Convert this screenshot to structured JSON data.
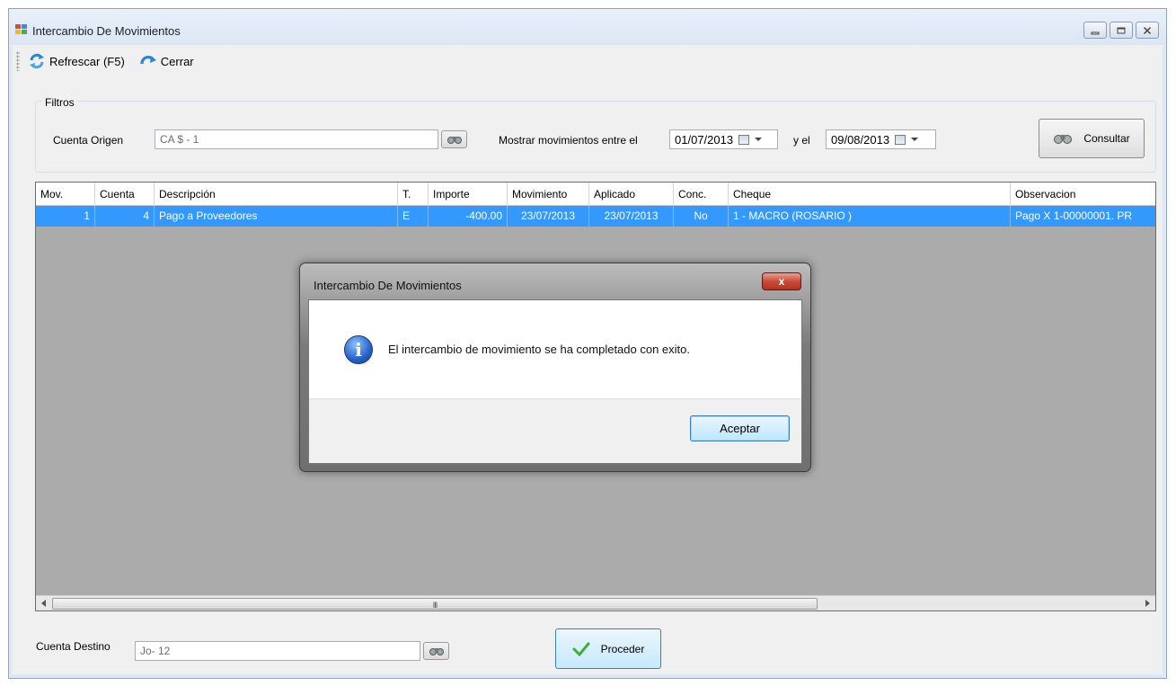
{
  "window": {
    "title": "Intercambio De Movimientos",
    "controls": [
      "minimize-icon",
      "maximize-icon",
      "close-icon"
    ]
  },
  "toolbar": {
    "refresh_label": "Refrescar (F5)",
    "close_label": "Cerrar"
  },
  "filters": {
    "group_label": "Filtros",
    "cuenta_origen_label": "Cuenta Origen",
    "cuenta_origen_value": "CA $ - 1",
    "mostrar_label": "Mostrar movimientos entre el",
    "date_from": "01/07/2013",
    "y_el_label": "y el",
    "date_to": "09/08/2013",
    "consultar_label": "Consultar"
  },
  "grid": {
    "columns": [
      "Mov.",
      "Cuenta",
      "Descripción",
      "T.",
      "Importe",
      "Movimiento",
      "Aplicado",
      "Conc.",
      "Cheque",
      "Observacion"
    ],
    "rows": [
      [
        "1",
        "4",
        "Pago a Proveedores",
        "E",
        "-400.00",
        "23/07/2013",
        "23/07/2013",
        "No",
        "1 - MACRO (ROSARIO )",
        "Pago X 1-00000001. PR"
      ]
    ],
    "selected_row_color": "#3399ff",
    "scroll_grip": "III"
  },
  "destino": {
    "label": "Cuenta Destino",
    "value": "Jo- 12",
    "proceder_label": "Proceder"
  },
  "dialog": {
    "title": "Intercambio De Movimientos",
    "message": "El intercambio de movimiento se ha completado con exito.",
    "ok_label": "Aceptar",
    "close_glyph": "x"
  }
}
